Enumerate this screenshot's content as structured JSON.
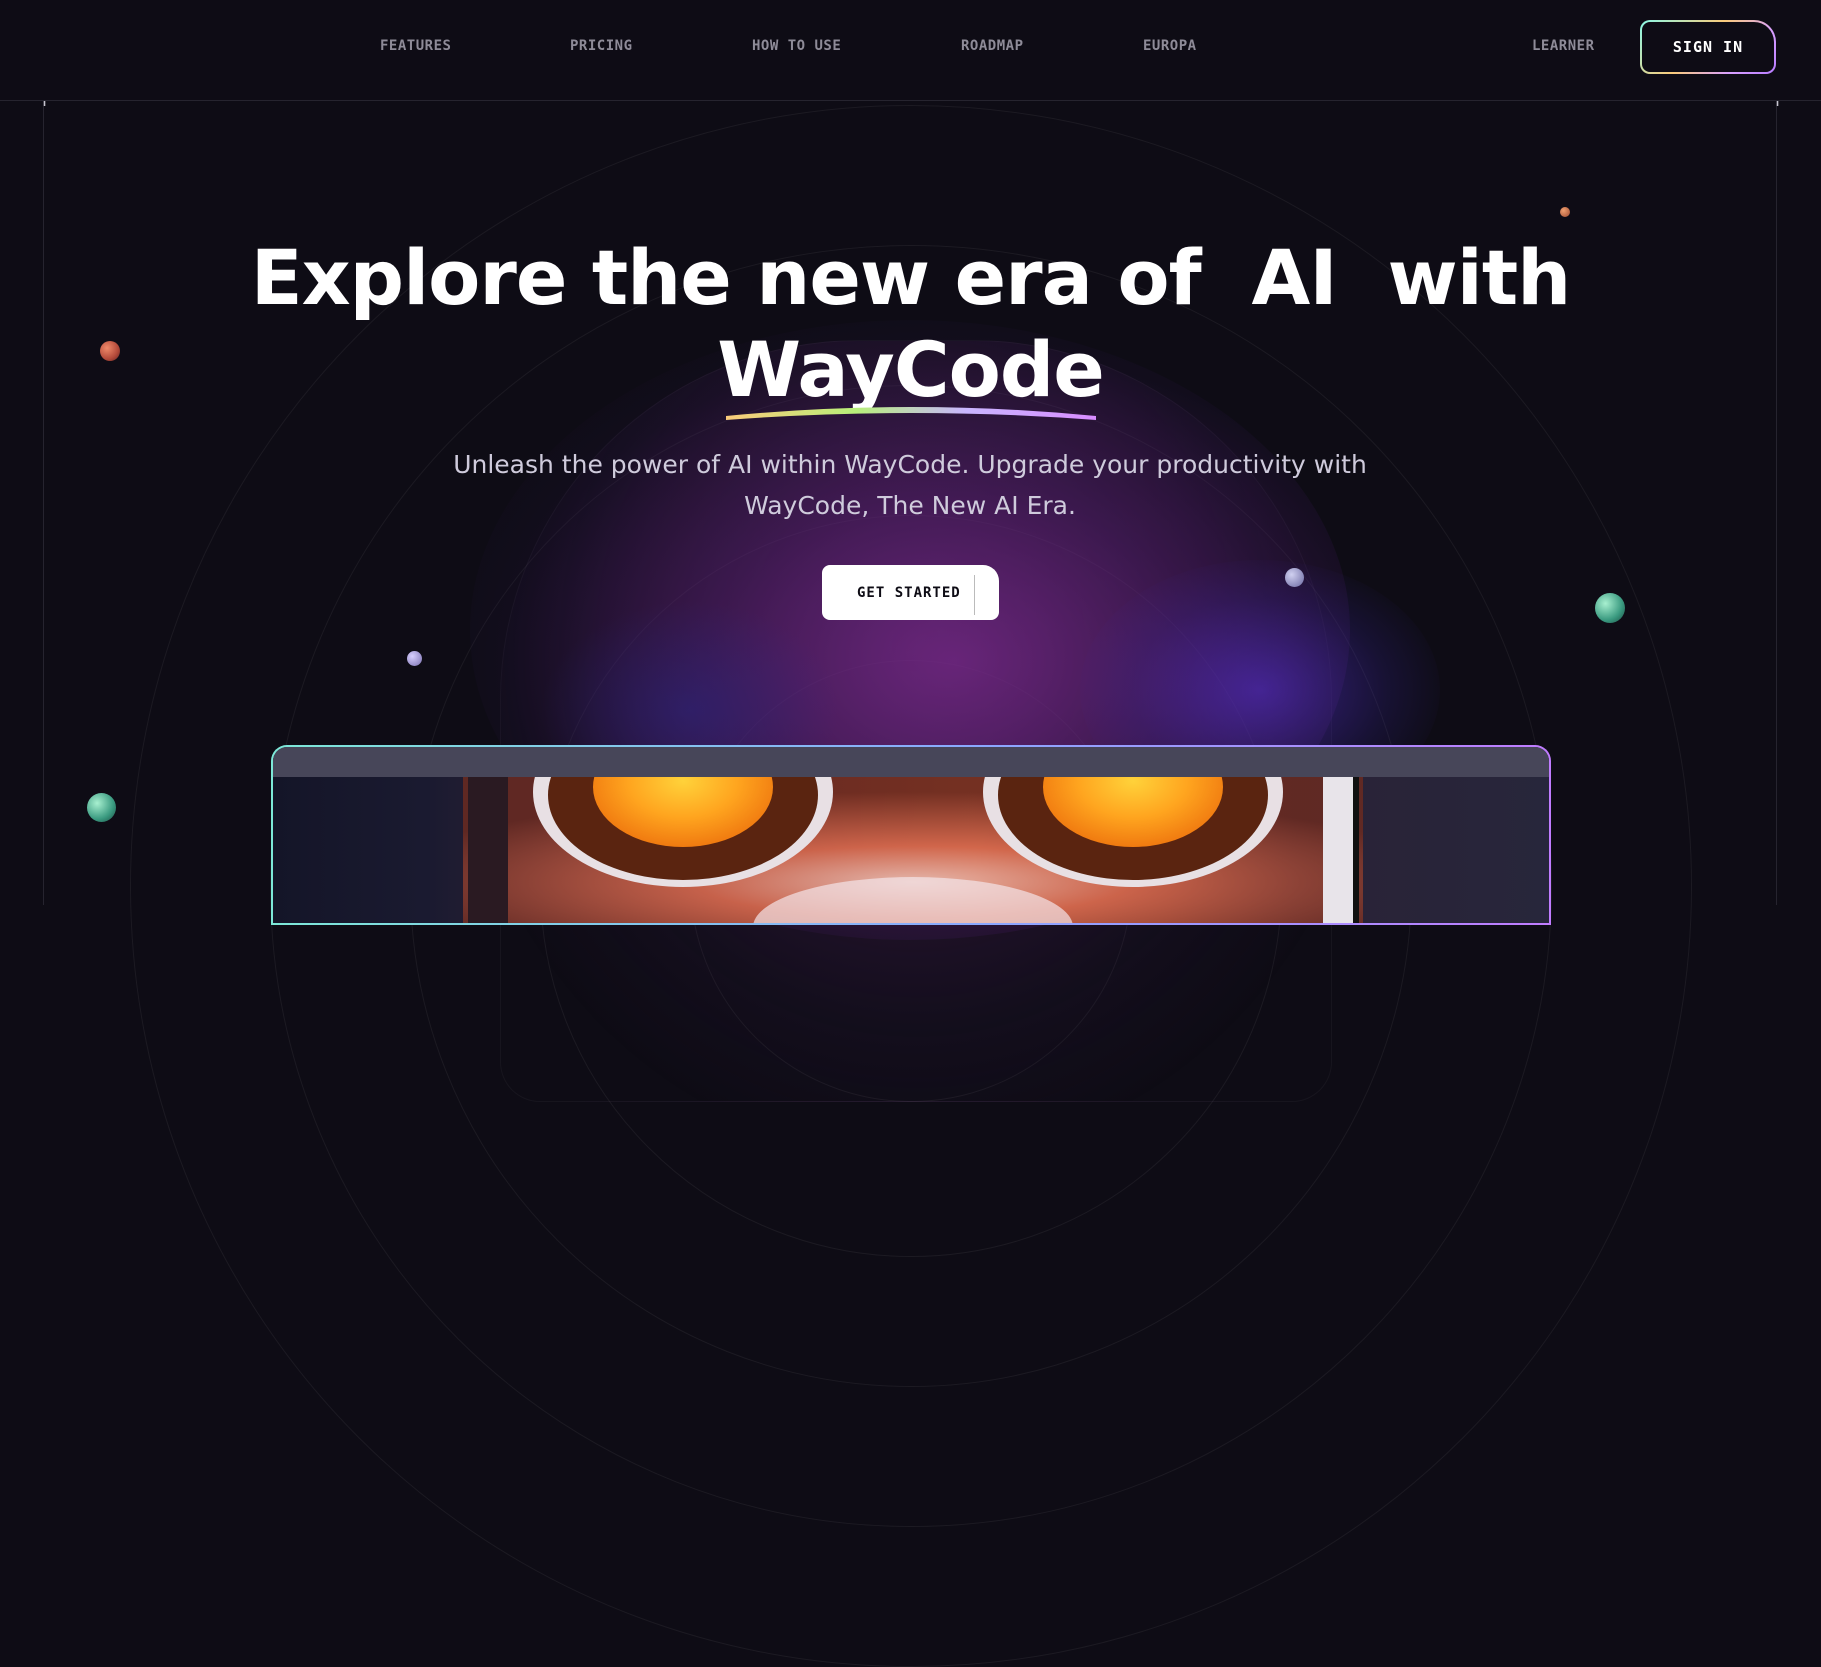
{
  "nav": {
    "items": [
      {
        "label": "FEATURES"
      },
      {
        "label": "PRICING"
      },
      {
        "label": "HOW TO USE"
      },
      {
        "label": "ROADMAP"
      },
      {
        "label": "EUROPA"
      }
    ],
    "learner_label": "LEARNER",
    "signin_label": "SIGN IN"
  },
  "hero": {
    "title_line1": "Explore the new era of  AI  with",
    "title_line2": "WayCode",
    "subtitle": "Unleash the power of AI within WayCode. Upgrade your productivity with WayCode, The New AI Era.",
    "cta_label": "GET STARTED"
  },
  "colors": {
    "background": "#0e0c15",
    "nav_text": "#8e8b98",
    "accent_gradient": [
      "#89f9e8",
      "#facb7b",
      "#d8a0ff",
      "#b67bff"
    ]
  }
}
